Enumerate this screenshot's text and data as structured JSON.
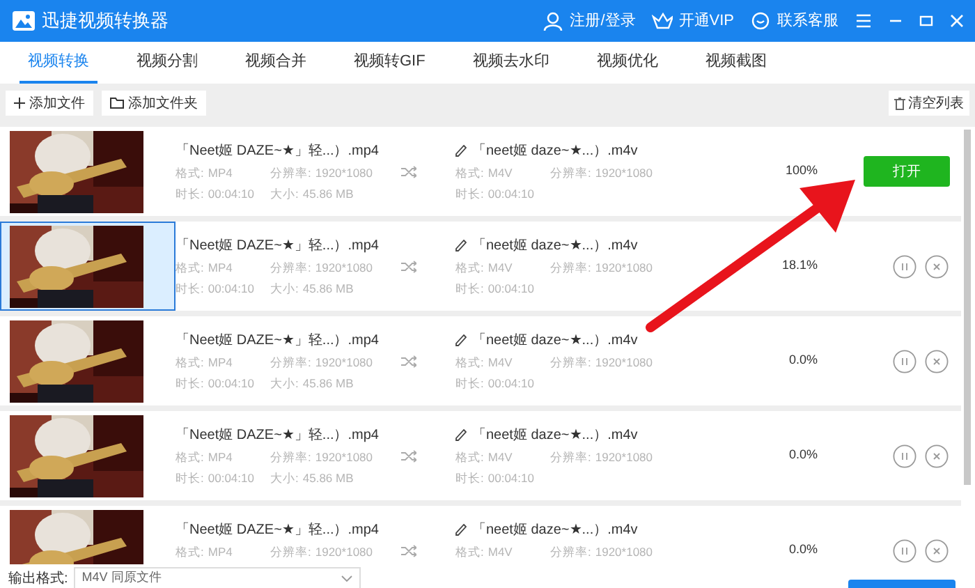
{
  "window": {
    "title": "迅捷视频转换器"
  },
  "header_links": [
    {
      "kind": "user",
      "label": "注册/登录"
    },
    {
      "kind": "vip",
      "label": "开通VIP"
    },
    {
      "kind": "chat",
      "label": "联系客服"
    }
  ],
  "tabs": [
    {
      "label": "视频转换",
      "selected": true
    },
    {
      "label": "视频分割",
      "selected": false
    },
    {
      "label": "视频合并",
      "selected": false
    },
    {
      "label": "视频转GIF",
      "selected": false
    },
    {
      "label": "视频去水印",
      "selected": false
    },
    {
      "label": "视频优化",
      "selected": false
    },
    {
      "label": "视频截图",
      "selected": false
    }
  ],
  "toolbar": {
    "add_file": "添加文件",
    "add_folder": "添加文件夹",
    "clear": "清空列表"
  },
  "files": [
    {
      "selected": false,
      "kind": "done",
      "name": "「Neet姬 DAZE~★」轻...）.mp4",
      "format_label": "格式:",
      "format": "MP4",
      "res_label": "分辨率:",
      "resolution": "1920*1080",
      "dur_label": "时长:",
      "duration": "00:04:10",
      "size_label": "大小:",
      "size": "45.86 MB",
      "out_name": "「neet姬 daze~★...）.m4v",
      "out_format_label": "格式:",
      "out_format": "M4V",
      "out_res_label": "分辨率:",
      "out_resolution": "1920*1080",
      "out_dur_label": "时长:",
      "out_duration": "00:04:10",
      "progress": "100%",
      "open_label": "打开"
    },
    {
      "selected": true,
      "kind": "converting",
      "name": "「Neet姬 DAZE~★」轻...）.mp4",
      "format_label": "格式:",
      "format": "MP4",
      "res_label": "分辨率:",
      "resolution": "1920*1080",
      "dur_label": "时长:",
      "duration": "00:04:10",
      "size_label": "大小:",
      "size": "45.86 MB",
      "out_name": "「neet姬 daze~★...）.m4v",
      "out_format_label": "格式:",
      "out_format": "M4V",
      "out_res_label": "分辨率:",
      "out_resolution": "1920*1080",
      "out_dur_label": "时长:",
      "out_duration": "00:04:10",
      "progress": "18.1%"
    },
    {
      "selected": false,
      "kind": "converting",
      "name": "「Neet姬 DAZE~★」轻...）.mp4",
      "format_label": "格式:",
      "format": "MP4",
      "res_label": "分辨率:",
      "resolution": "1920*1080",
      "dur_label": "时长:",
      "duration": "00:04:10",
      "size_label": "大小:",
      "size": "45.86 MB",
      "out_name": "「neet姬 daze~★...）.m4v",
      "out_format_label": "格式:",
      "out_format": "M4V",
      "out_res_label": "分辨率:",
      "out_resolution": "1920*1080",
      "out_dur_label": "时长:",
      "out_duration": "00:04:10",
      "progress": "0.0%"
    },
    {
      "selected": false,
      "kind": "converting",
      "name": "「Neet姬 DAZE~★」轻...）.mp4",
      "format_label": "格式:",
      "format": "MP4",
      "res_label": "分辨率:",
      "resolution": "1920*1080",
      "dur_label": "时长:",
      "duration": "00:04:10",
      "size_label": "大小:",
      "size": "45.86 MB",
      "out_name": "「neet姬 daze~★...）.m4v",
      "out_format_label": "格式:",
      "out_format": "M4V",
      "out_res_label": "分辨率:",
      "out_resolution": "1920*1080",
      "out_dur_label": "时长:",
      "out_duration": "00:04:10",
      "progress": "0.0%"
    },
    {
      "selected": false,
      "kind": "converting",
      "name": "「Neet姬 DAZE~★」轻...）.mp4",
      "format_label": "格式:",
      "format": "MP4",
      "res_label": "分辨率:",
      "resolution": "1920*1080",
      "out_name": "「neet姬 daze~★...）.m4v",
      "out_format_label": "格式:",
      "out_format": "M4V",
      "out_res_label": "分辨率:",
      "out_resolution": "1920*1080",
      "progress": "0.0%"
    }
  ],
  "footer": {
    "label": "输出格式:",
    "format_value": "M4V 同原文件"
  }
}
